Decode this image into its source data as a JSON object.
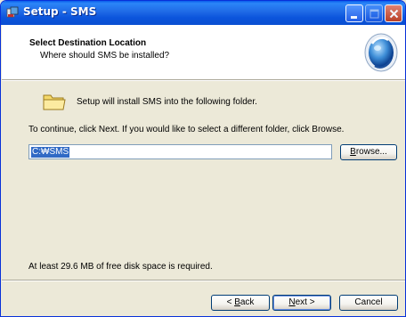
{
  "window": {
    "title": "Setup - SMS",
    "title_color": "#0A54DC"
  },
  "header": {
    "title": "Select Destination Location",
    "subtitle": "Where should SMS be installed?"
  },
  "body": {
    "install_message": "Setup will install SMS into the following folder.",
    "continue_message": "To continue, click Next. If you would like to select a different folder, click Browse.",
    "path_value": "C:\\SMS",
    "path_display": "C:₩SMS",
    "browse_label_prefix": "B",
    "browse_label_rest": "rowse...",
    "disk_space_message": "At least 29.6 MB of free disk space is required."
  },
  "buttons": {
    "back_prefix": "< ",
    "back_accel": "B",
    "back_rest": "ack",
    "next_accel": "N",
    "next_rest": "ext >",
    "cancel": "Cancel"
  },
  "icons": {
    "title": "setup-app-icon",
    "folder": "folder-icon",
    "header_logo": "installer-logo-icon",
    "minimize": "minimize-icon",
    "maximize": "maximize-icon",
    "close": "close-icon"
  },
  "colors": {
    "selection": "#316AC5",
    "dialog_bg": "#ECE9D8"
  }
}
